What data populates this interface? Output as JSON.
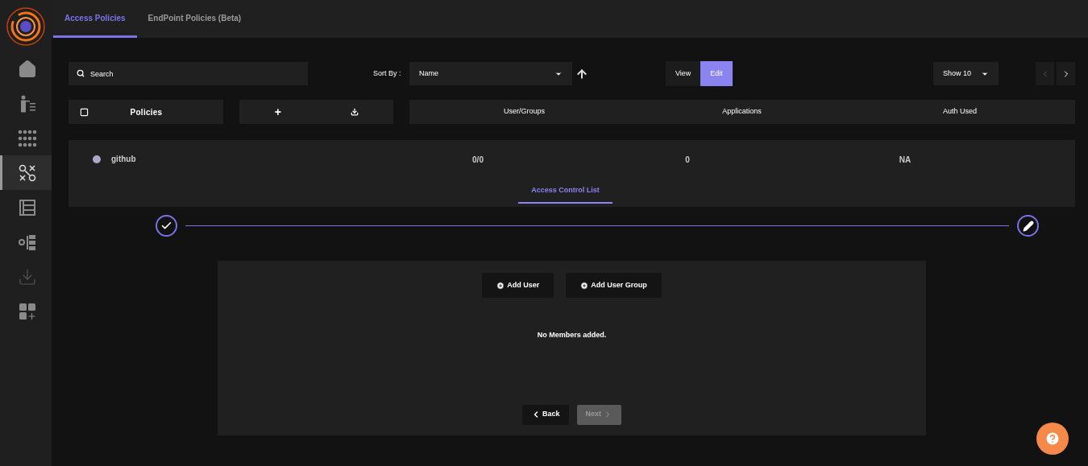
{
  "sidebar": {
    "items": [
      {
        "kind": "home",
        "selected": false
      },
      {
        "kind": "users",
        "selected": false
      },
      {
        "kind": "grid",
        "selected": false
      },
      {
        "kind": "policies",
        "selected": true
      },
      {
        "kind": "list",
        "selected": false
      },
      {
        "kind": "settings",
        "selected": false
      },
      {
        "kind": "download",
        "selected": false
      },
      {
        "kind": "apps",
        "selected": false
      }
    ]
  },
  "tabs": [
    {
      "label": "Access Policies",
      "selected": true
    },
    {
      "label": "EndPoint Policies (Beta)",
      "selected": false
    }
  ],
  "toolbar": {
    "search": {
      "placeholder": "Search"
    },
    "sort_label": "Sort By :",
    "sort_value": "Name",
    "mode": [
      {
        "label": "View",
        "selected": false
      },
      {
        "label": "Edit",
        "selected": true
      }
    ],
    "page_size": "Show 10"
  },
  "table": {
    "select_all": {
      "checked": false
    },
    "policies_header": "Policies",
    "add_button": "+",
    "columns": [
      "User/Groups",
      "Applications",
      "Auth Used"
    ]
  },
  "rows": [
    {
      "name": "github",
      "color": "#a9a8c8",
      "cells": [
        "0/0",
        "0",
        "NA"
      ],
      "subtab": "Access Control List"
    }
  ],
  "stepper": {
    "steps": [
      {
        "kind": "done"
      },
      {
        "kind": "edit"
      }
    ]
  },
  "panel": {
    "buttons": [
      "Add User",
      "Add User Group"
    ],
    "message": "No Members added.",
    "back": "Back",
    "next": {
      "label": "Next",
      "disabled": true
    }
  }
}
